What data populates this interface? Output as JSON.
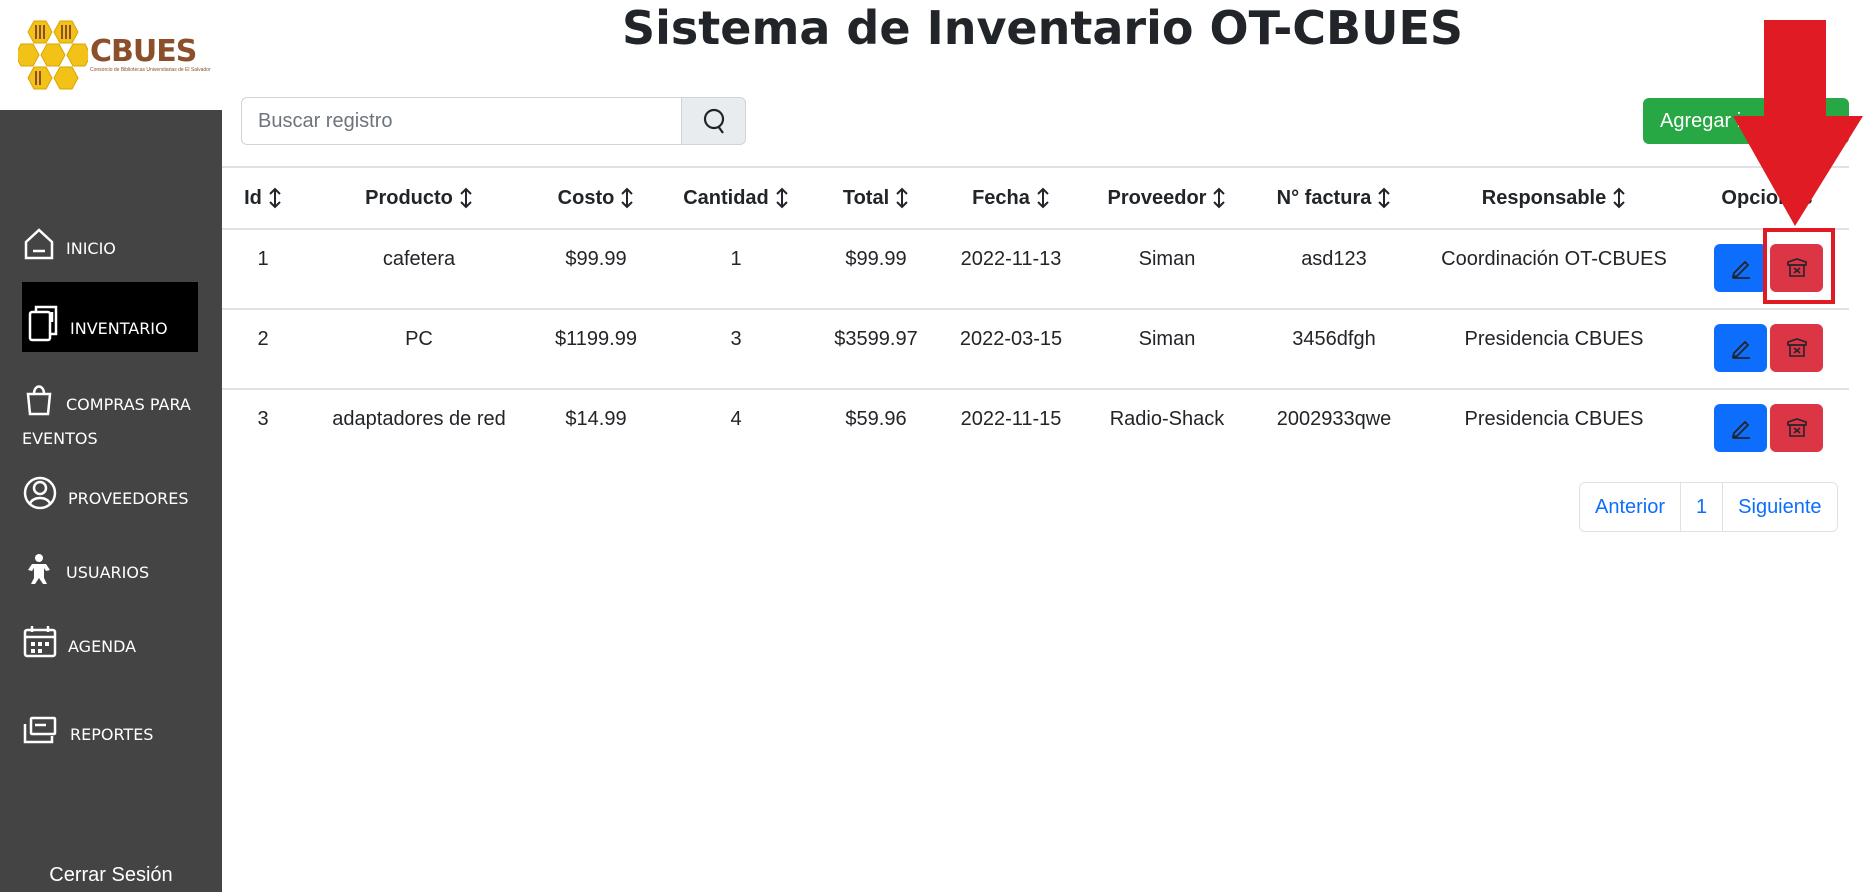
{
  "page": {
    "title": "Sistema de Inventario OT-CBUES"
  },
  "logo": {
    "text": "CBUES",
    "subtitle": "Consorcio de Bibliotecas Universitarias de El Salvador"
  },
  "sidebar": {
    "items": [
      {
        "label": "INICIO",
        "icon": "home-icon"
      },
      {
        "label": "INVENTARIO",
        "icon": "book-icon"
      },
      {
        "label": "COMPRAS PARA",
        "label2": "EVENTOS",
        "icon": "shopping-bag-icon"
      },
      {
        "label": "PROVEEDORES",
        "icon": "person-circle-icon"
      },
      {
        "label": "USUARIOS",
        "icon": "child-user-icon"
      },
      {
        "label": "AGENDA",
        "icon": "calendar-icon"
      },
      {
        "label": "REPORTES",
        "icon": "mail-card-icon"
      }
    ],
    "active": "INVENTARIO",
    "logout_label": "Cerrar Sesión"
  },
  "search": {
    "placeholder": "Buscar registro",
    "value": ""
  },
  "toolbar": {
    "add_label": "Agregar inventario"
  },
  "table": {
    "headers": [
      "Id",
      "Producto",
      "Costo",
      "Cantidad",
      "Total",
      "Fecha",
      "Proveedor",
      "N° factura",
      "Responsable",
      "Opciones"
    ],
    "rows": [
      {
        "id": "1",
        "producto": "cafetera",
        "costo": "$99.99",
        "cantidad": "1",
        "total": "$99.99",
        "fecha": "2022-11-13",
        "proveedor": "Siman",
        "factura": "asd123",
        "responsable": "Coordinación OT-CBUES"
      },
      {
        "id": "2",
        "producto": "PC",
        "costo": "$1199.99",
        "cantidad": "3",
        "total": "$3599.97",
        "fecha": "2022-03-15",
        "proveedor": "Siman",
        "factura": "3456dfgh",
        "responsable": "Presidencia CBUES"
      },
      {
        "id": "3",
        "producto": "adaptadores de red",
        "costo": "$14.99",
        "cantidad": "4",
        "total": "$59.96",
        "fecha": "2022-11-15",
        "proveedor": "Radio-Shack",
        "factura": "2002933qwe",
        "responsable": "Presidencia CBUES"
      }
    ]
  },
  "pagination": {
    "prev": "Anterior",
    "current": "1",
    "next": "Siguiente"
  },
  "colors": {
    "sidebar_bg": "#444444",
    "active_bg": "#000000",
    "primary": "#0d6efd",
    "danger": "#dc3545",
    "success": "#28a745",
    "annotation": "#e01b24"
  }
}
